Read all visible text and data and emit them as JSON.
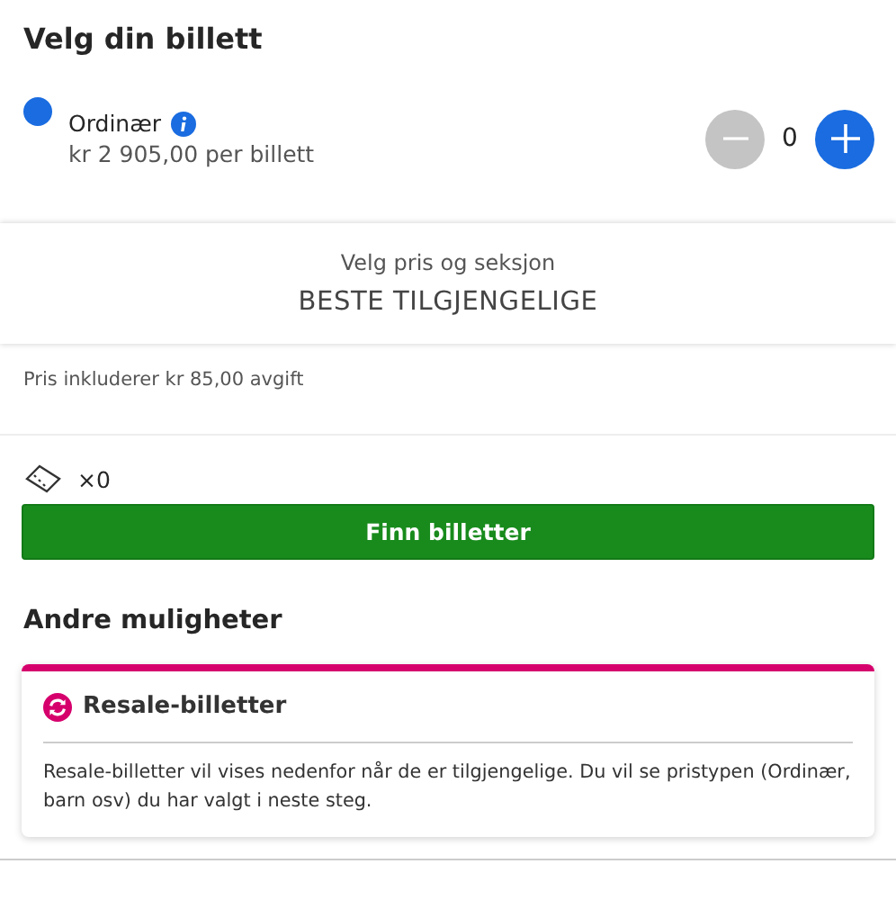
{
  "title": "Velg din billett",
  "ticket_types": [
    {
      "name": "Ordinær",
      "price": "kr 2 905,00 per billett",
      "color": "#1a6ce0",
      "count": "0",
      "decrease_disabled": true,
      "increase_disabled": false
    }
  ],
  "seat_selector": {
    "label": "Velg pris og seksjon",
    "value": "BESTE TILGJENGELIGE"
  },
  "fee_note": "Pris inkluderer kr 85,00 avgift",
  "ticket_count": "×0",
  "find_button": "Finn billetter",
  "other_options": {
    "heading": "Andre muligheter",
    "card": {
      "title": "Resale-billetter",
      "text": "Resale-billetter vil vises nedenfor når de er tilgjengelige. Du vil se pristypen (Ordinær, barn osv) du har valgt i neste steg."
    }
  }
}
